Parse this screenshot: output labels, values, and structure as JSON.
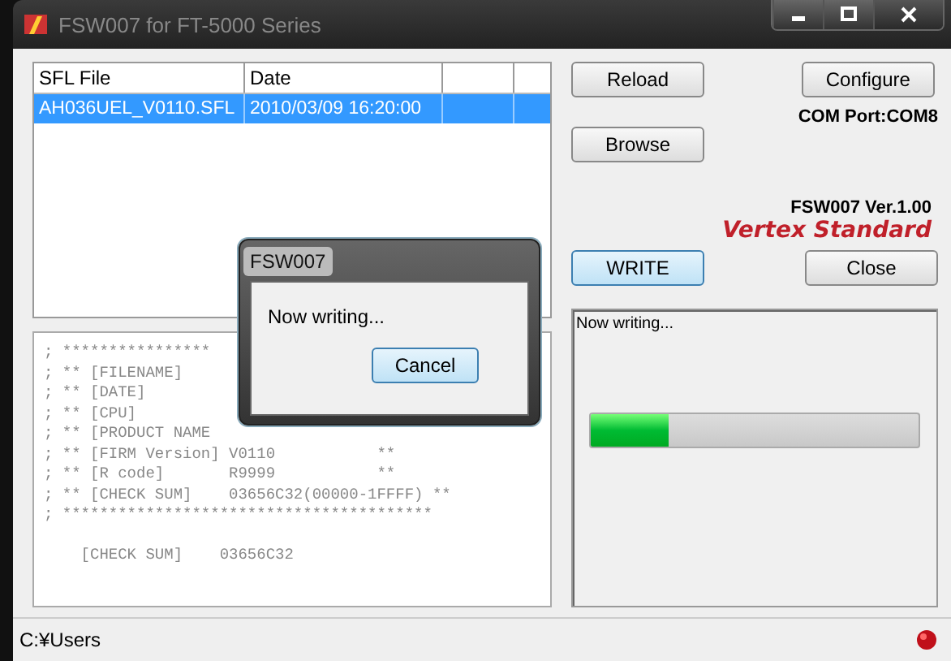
{
  "window": {
    "title": "FSW007 for FT-5000 Series"
  },
  "file_list": {
    "columns": [
      "SFL File",
      "Date"
    ],
    "rows": [
      {
        "cells": [
          "AH036UEL_V0110.SFL",
          "2010/03/09 16:20:00"
        ],
        "selected": true
      }
    ]
  },
  "buttons": {
    "reload": "Reload",
    "configure": "Configure",
    "browse": "Browse",
    "write": "WRITE",
    "close": "Close"
  },
  "com_port": "COM Port:COM8",
  "version": "FSW007 Ver.1.00",
  "brand": "Vertex Standard",
  "log": {
    "header_lines": [
      "; ****************",
      "; ** [FILENAME]",
      "; ** [DATE]",
      "; ** [CPU]",
      "; ** [PRODUCT NAME",
      "; ** [FIRM Version] V0110           **",
      "; ** [R code]       R9999           **",
      "; ** [CHECK SUM]    03656C32(00000-1FFFF) **",
      "; ****************************************"
    ],
    "checksum_line": "    [CHECK SUM]    03656C32"
  },
  "progress": {
    "status": "Now writing...",
    "level": 0.24
  },
  "dialog": {
    "title": "FSW007",
    "message": "Now writing...",
    "button": "Cancel"
  },
  "status_bar": {
    "path": "C:¥Users"
  }
}
